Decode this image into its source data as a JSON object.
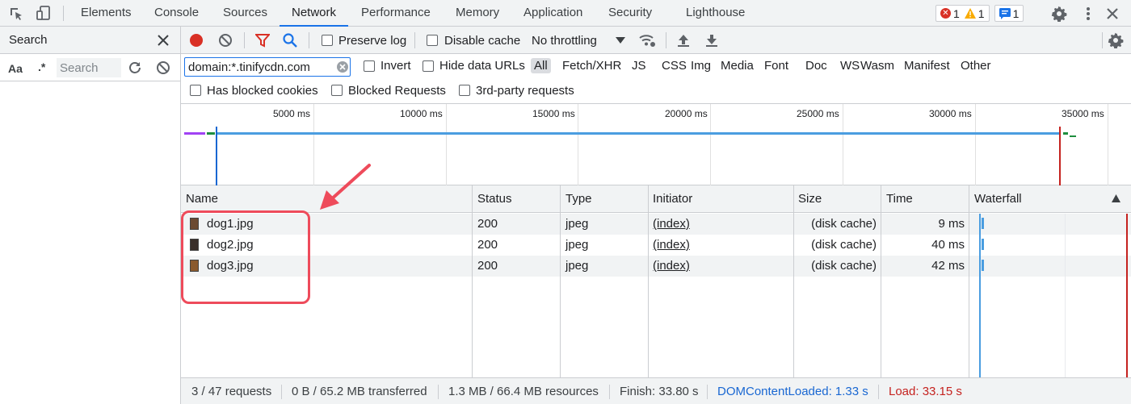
{
  "tabs": [
    "Elements",
    "Console",
    "Sources",
    "Network",
    "Performance",
    "Memory",
    "Application",
    "Security",
    "Lighthouse"
  ],
  "active_tab": "Network",
  "badges": {
    "errors": "1",
    "warnings": "1",
    "messages": "1"
  },
  "search_pane": {
    "title": "Search",
    "case_label": "Aa",
    "regex_label": ".*",
    "placeholder": "Search"
  },
  "toolbar": {
    "preserve_log": "Preserve log",
    "disable_cache": "Disable cache",
    "throttling": "No throttling"
  },
  "filter": {
    "value": "domain:*.tinifycdn.com",
    "invert": "Invert",
    "hide_data_urls": "Hide data URLs",
    "types": [
      "All",
      "Fetch/XHR",
      "JS",
      "CSS",
      "Img",
      "Media",
      "Font",
      "Doc",
      "WS",
      "Wasm",
      "Manifest",
      "Other"
    ],
    "has_blocked_cookies": "Has blocked cookies",
    "blocked_requests": "Blocked Requests",
    "third_party": "3rd-party requests"
  },
  "overview": {
    "ticks": [
      "5000 ms",
      "10000 ms",
      "15000 ms",
      "20000 ms",
      "25000 ms",
      "30000 ms",
      "35000 ms"
    ]
  },
  "table": {
    "columns": [
      "Name",
      "Status",
      "Type",
      "Initiator",
      "Size",
      "Time",
      "Waterfall"
    ],
    "rows": [
      {
        "name": "dog1.jpg",
        "status": "200",
        "type": "jpeg",
        "initiator": "(index)",
        "size": "(disk cache)",
        "time": "9 ms"
      },
      {
        "name": "dog2.jpg",
        "status": "200",
        "type": "jpeg",
        "initiator": "(index)",
        "size": "(disk cache)",
        "time": "40 ms"
      },
      {
        "name": "dog3.jpg",
        "status": "200",
        "type": "jpeg",
        "initiator": "(index)",
        "size": "(disk cache)",
        "time": "42 ms"
      }
    ]
  },
  "status_bar": {
    "requests": "3 / 47 requests",
    "transferred": "0 B / 65.2 MB transferred",
    "resources": "1.3 MB / 66.4 MB resources",
    "finish": "Finish: 33.80 s",
    "dom_content_loaded": "DOMContentLoaded: 1.33 s",
    "load": "Load: 33.15 s"
  },
  "colors": {
    "accent": "#1a73e8",
    "record": "#d93025",
    "annotation": "#ee4b5b",
    "dcl": "#1967d2",
    "load": "#c5221f"
  }
}
